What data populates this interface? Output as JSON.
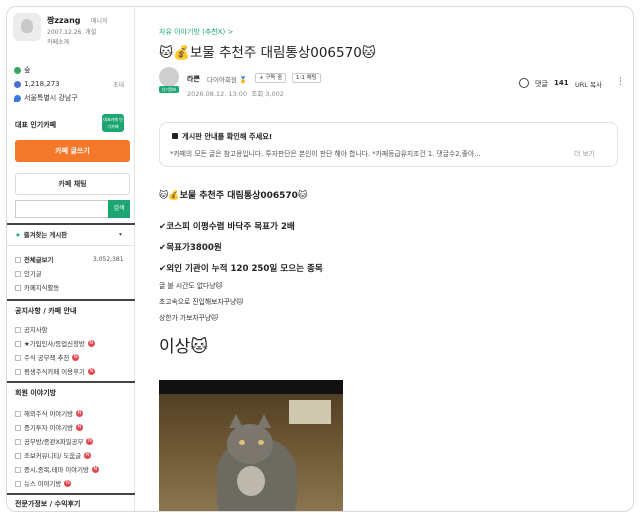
{
  "sidebar": {
    "cafe_name": "짱zzang",
    "cafe_role": "매니저",
    "cafe_date": "2007.12.26. 개설",
    "cafe_intro": "카페소개",
    "level": "숲",
    "members": "1,218,273",
    "invite": "초대",
    "location": "서울특별시 강남구",
    "best_label": "대표 인기카페",
    "best_badge": "대표카페 인기카페",
    "write_button": "카페 글쓰기",
    "chat_button": "카페 채팅",
    "search_placeholder": "",
    "search_button": "검색",
    "favorites": "즐겨찾는 게시판",
    "favorites_chevron": "▾",
    "menu_all": "전체글보기",
    "menu_all_count": "3,052,381",
    "menu_popular": "인기글",
    "menu_knowledge": "카페지식활동",
    "section1_title": "공지사항 / 카페 안내",
    "section1_items": [
      "공지사항",
      "★가입인사/등업신청방",
      "주식 공부책 추천",
      "평생주식카페 이용후기"
    ],
    "section2_title": "회원 이야기방",
    "section2_items": [
      "해외주식 이야기방",
      "증기투자 이야기방",
      "공부방/종관X파일공부",
      "조보커뮤니티/ 도움글",
      "증시,종목,테마 이야기방",
      "뉴스 이야기방"
    ],
    "section3_title": "전문가정보 / 수익후기",
    "new_mark": "N"
  },
  "post": {
    "board": "자유 이야기방 (추천X) >",
    "title": "🐱💰보물 추천주 대림통상006570🐱",
    "author": "라쁜",
    "grade": "다이아회원 🥇",
    "subscribe": "+ 구독 중",
    "one_on_one": "1:1 채팅",
    "avatar_tag": "인기멤버",
    "date": "2026.08.12. 13:00",
    "views": "조회 3,002",
    "comment_label": "댓글",
    "comment_count": "141",
    "url_copy": "URL 복사",
    "more": "⋮"
  },
  "notice": {
    "title": "게시판 안내를 확인해 주세요!",
    "body": "*카페의 모든 글은 참고용입니다. 투자판단은 본인이 판단 해야 합니다. *카페등급유지조건 1. 댓글수2,좋아...",
    "more": "더 보기"
  },
  "content": {
    "title": "🐱💰보물 추천주 대림통상006570🐱",
    "line1": "✔코스피 이평수렴 바닥주 목표가 2배",
    "line2": "✔목표가3800원",
    "line3": "✔외인 기관이 누적 120 250일 모으는 종목",
    "line4": "글 볼 시간도 없다냥🐱",
    "line5": "초고속으로 진입해보자꾸냥🐱",
    "line6": "상한가 가보자꾸냥🐱",
    "big": "이상🐱"
  }
}
